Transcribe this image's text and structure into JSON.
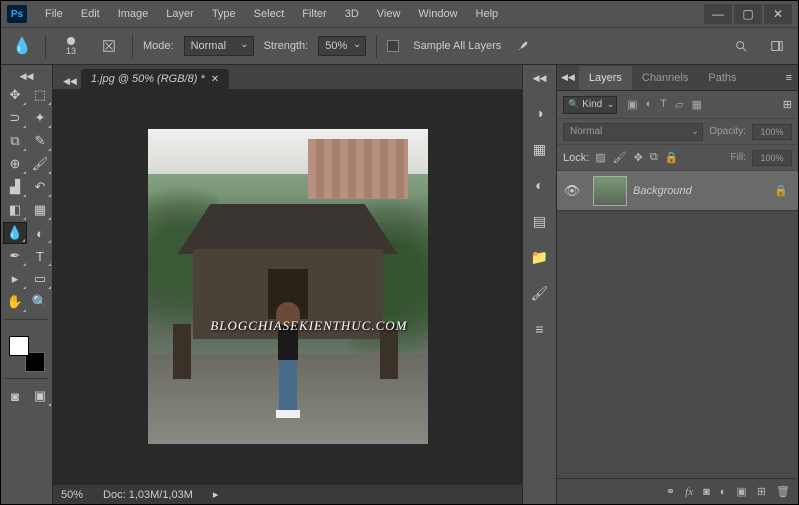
{
  "app": {
    "logo": "Ps"
  },
  "menu": [
    "File",
    "Edit",
    "Image",
    "Layer",
    "Type",
    "Select",
    "Filter",
    "3D",
    "View",
    "Window",
    "Help"
  ],
  "window_controls": {
    "minimize": "—",
    "maximize": "▢",
    "close": "✕"
  },
  "options": {
    "brush_size": "13",
    "mode_label": "Mode:",
    "mode_value": "Normal",
    "strength_label": "Strength:",
    "strength_value": "50%",
    "sample_all_label": "Sample All Layers"
  },
  "document": {
    "tab_title": "1.jpg @ 50% (RGB/8) *",
    "zoom": "50%",
    "doc_info": "Doc: 1,03M/1,03M",
    "watermark": "BLOGCHIASEKIENTHUC.COM"
  },
  "panels": {
    "tabs": [
      "Layers",
      "Channels",
      "Paths"
    ],
    "filter_kind": "Kind",
    "blend_mode": "Normal",
    "opacity_label": "Opacity:",
    "opacity_value": "100%",
    "lock_label": "Lock:",
    "fill_label": "Fill:",
    "fill_value": "100%"
  },
  "layers": [
    {
      "name": "Background",
      "visible": true,
      "locked": true
    }
  ],
  "colors": {
    "fg": "#ffffff",
    "bg": "#000000"
  }
}
